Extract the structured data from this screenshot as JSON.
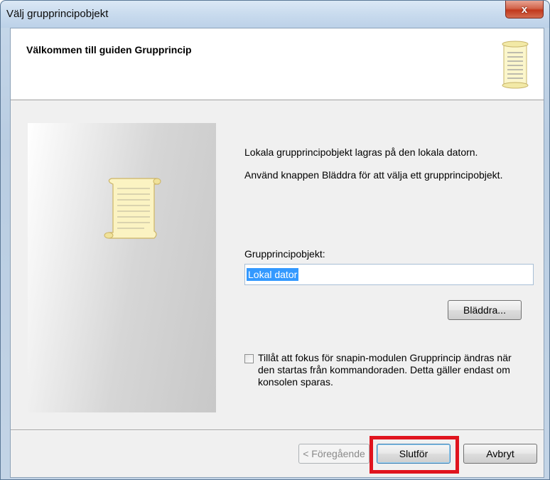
{
  "window": {
    "title": "Välj grupprincipobjekt",
    "close_label": "x"
  },
  "header": {
    "title": "Välkommen till guiden Grupprincip",
    "icon": "scroll-document-icon"
  },
  "side_panel": {
    "icon": "scroll-document-icon"
  },
  "body": {
    "info_line1": "Lokala grupprincipobjekt lagras på den lokala datorn.",
    "info_line2": "Använd knappen Bläddra för att välja ett grupprincipobjekt.",
    "gpo_label": "Grupprincipobjekt:",
    "gpo_value": "Lokal dator",
    "browse_button": "Bläddra...",
    "checkbox_label": "Tillåt att fokus för snapin-modulen Grupprincip ändras när den startas från kommandoraden. Detta gäller endast om konsolen sparas.",
    "checkbox_checked": false
  },
  "footer": {
    "back_button": "< Föregående",
    "finish_button": "Slutför",
    "cancel_button": "Avbryt"
  },
  "colors": {
    "highlight": "#e0141e",
    "selection": "#3399ff"
  }
}
